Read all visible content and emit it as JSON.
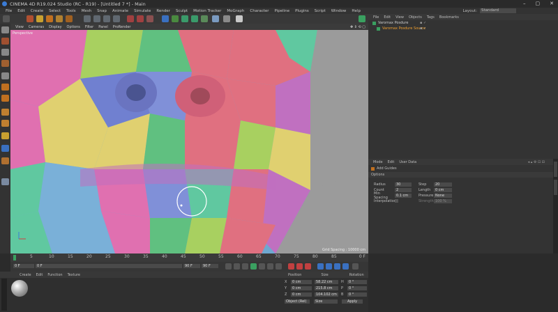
{
  "window": {
    "title": "CINEMA 4D R19.024 Studio (RC - R19) - [Untitled 7 *] - Main"
  },
  "menu": [
    "File",
    "Edit",
    "Create",
    "Select",
    "Tools",
    "Mesh",
    "Snap",
    "Animate",
    "Simulate",
    "Render",
    "Sculpt",
    "Motion Tracker",
    "MoGraph",
    "Character",
    "Pipeline",
    "Plugins",
    "Script",
    "Window",
    "Help"
  ],
  "layout": {
    "label": "Layout:",
    "value": "Standard"
  },
  "viewport": {
    "menu": [
      "View",
      "Cameras",
      "Display",
      "Options",
      "Filter",
      "Panel",
      "ProRender"
    ],
    "name": "Perspective",
    "grid_spacing": "Grid Spacing : 10000 cm"
  },
  "object_manager": {
    "menu": [
      "File",
      "Edit",
      "View",
      "Objects",
      "Tags",
      "Bookmarks"
    ],
    "items": [
      "Varomax Posdure",
      "Varomax Posdure Source"
    ]
  },
  "attributes": {
    "menu": [
      "Mode",
      "Edit",
      "User Data"
    ],
    "object": "Add Guides",
    "section": "Options",
    "fields": [
      {
        "label": "Radius",
        "value": "30"
      },
      {
        "label": "Count",
        "value": "2"
      },
      {
        "label": "Min Spacing",
        "value": "0.1 cm"
      },
      {
        "label": "Interpolation",
        "value": ""
      }
    ],
    "right_fields": [
      {
        "label": "Step",
        "value": "20"
      },
      {
        "label": "Length",
        "value": "0 cm"
      },
      {
        "label": "Pressure",
        "value": "None"
      },
      {
        "label": "Strength",
        "value": "100 %"
      }
    ]
  },
  "timeline": {
    "ticks": [
      "0",
      "5",
      "10",
      "15",
      "20",
      "25",
      "30",
      "35",
      "40",
      "45",
      "50",
      "55",
      "60",
      "65",
      "70",
      "75",
      "80",
      "85",
      "90"
    ],
    "end_label": "0 F",
    "start_field": "0 F",
    "current_field": "0 F",
    "end_field": "90 F",
    "end_field2": "90 F"
  },
  "materials": {
    "menu": [
      "Create",
      "Edit",
      "Function",
      "Texture"
    ]
  },
  "coordinates": {
    "headers": [
      "Position",
      "Size",
      "Rotation"
    ],
    "rows": [
      {
        "axis": "X",
        "pos": "0 cm",
        "size": "58.22 cm",
        "rot_axis": "H",
        "rot": "0 °"
      },
      {
        "axis": "Y",
        "pos": "0 cm",
        "size": "215.8 cm",
        "rot_axis": "P",
        "rot": "0 °"
      },
      {
        "axis": "Z",
        "pos": "0 cm",
        "size": "104.102 cm",
        "rot_axis": "B",
        "rot": "0 °"
      }
    ],
    "mode": "Object (Rel)",
    "size_mode": "Size",
    "apply": "Apply"
  },
  "colors": {
    "accent": "#f0a030",
    "selected": "#f0a030"
  }
}
